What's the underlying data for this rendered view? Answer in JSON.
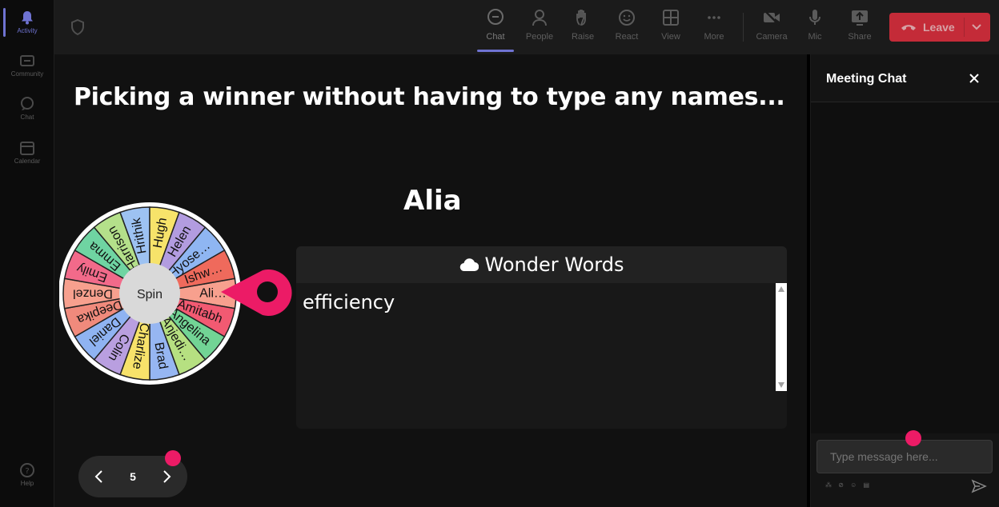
{
  "rail": {
    "items": [
      {
        "label": "Activity",
        "icon": "bell-icon",
        "active": true
      },
      {
        "label": "Community",
        "icon": "community-icon"
      },
      {
        "label": "Chat",
        "icon": "chat-icon"
      },
      {
        "label": "Calendar",
        "icon": "calendar-icon"
      }
    ],
    "help": {
      "label": "Help",
      "icon": "help-icon"
    }
  },
  "toolbar": {
    "chat": "Chat",
    "people": "People",
    "raise": "Raise",
    "react": "React",
    "view": "View",
    "more": "More",
    "camera": "Camera",
    "mic": "Mic",
    "share": "Share",
    "leave": "Leave"
  },
  "stage": {
    "title": "Picking a winner without having to type any names...",
    "winner": "Alia",
    "spin_label": "Spin",
    "wheel_names": [
      "Ali…",
      "Amitabh",
      "Angelina",
      "Anjedi…",
      "Brad",
      "Charlize",
      "Colin",
      "Daniel",
      "Deepika",
      "Denzel",
      "Emily",
      "Emma",
      "Harrison",
      "Hrithik",
      "Hugh",
      "Helen",
      "Hyose…",
      "Ishw…"
    ],
    "wheel_colors": [
      "#f7a08e",
      "#f25a72",
      "#72d495",
      "#b6e081",
      "#96b6f2",
      "#f7e26a",
      "#b99fe0",
      "#8fb3f2",
      "#f08a7c",
      "#f7a08e",
      "#f26a8a",
      "#6fd4a2",
      "#b4e08a",
      "#9dc2f2",
      "#f7e36a",
      "#b29ce0",
      "#8fb6f2",
      "#ef6a5c"
    ],
    "word_panel": {
      "title": "Wonder Words",
      "content": "efficiency"
    },
    "pager": {
      "page": "5"
    }
  },
  "chat": {
    "title": "Meeting Chat",
    "input_placeholder": "Type message here..."
  },
  "colors": {
    "accent": "#6f73d2",
    "leave": "#c42b38",
    "pin": "#ec1b66"
  }
}
